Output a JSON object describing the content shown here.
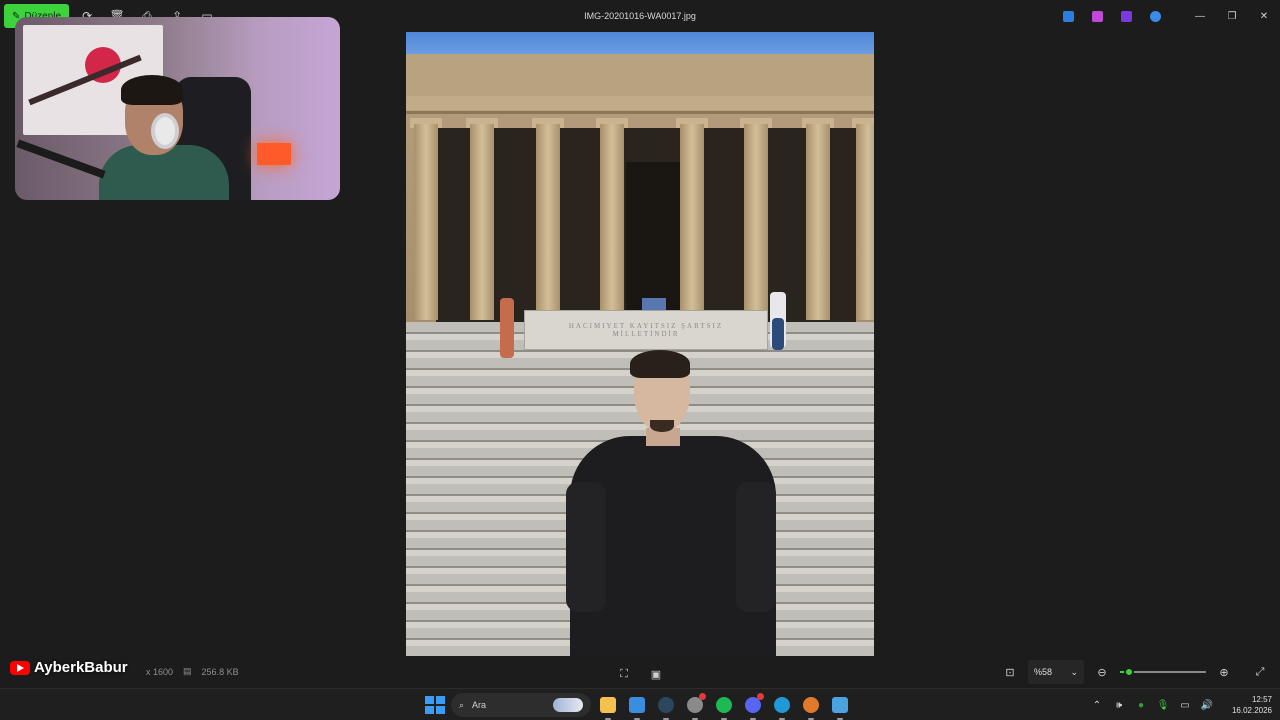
{
  "title_bar": {
    "edit_label": "Düzenle",
    "file_name": "IMG-20201016-WA0017.jpg",
    "toolbar_icons": [
      "rotate-icon",
      "delete-icon",
      "print-icon",
      "share-icon",
      "slideshow-icon",
      "more-icon"
    ],
    "extension_colors": [
      "#2b7de0",
      "#c04ad8",
      "#7a3ae0",
      "#3a8be8"
    ]
  },
  "photo": {
    "plinth_text": "HACIMIYET KAYITSIZ ŞARTSIZ MİLLETİNDİR"
  },
  "bottom_bar": {
    "dimensions": "x 1600",
    "file_size": "256.8 KB",
    "zoom_value": "%58",
    "zoom_fraction": 0.1
  },
  "overlay": {
    "channel_name": "AyberkBabur"
  },
  "taskbar": {
    "search_placeholder": "Ara",
    "apps": [
      {
        "name": "file-explorer",
        "color": "#f2c14e"
      },
      {
        "name": "photos",
        "color": "#3a8ee0"
      },
      {
        "name": "steam",
        "color": "#2a475e"
      },
      {
        "name": "spotify",
        "color": "#1db954"
      },
      {
        "name": "discord",
        "color": "#5865f2"
      },
      {
        "name": "edge",
        "color": "#1f9ad6"
      },
      {
        "name": "media-player",
        "color": "#e07a2b"
      },
      {
        "name": "paint",
        "color": "#4aa3df"
      }
    ],
    "time": "12:57",
    "date": "16.02.2026"
  }
}
